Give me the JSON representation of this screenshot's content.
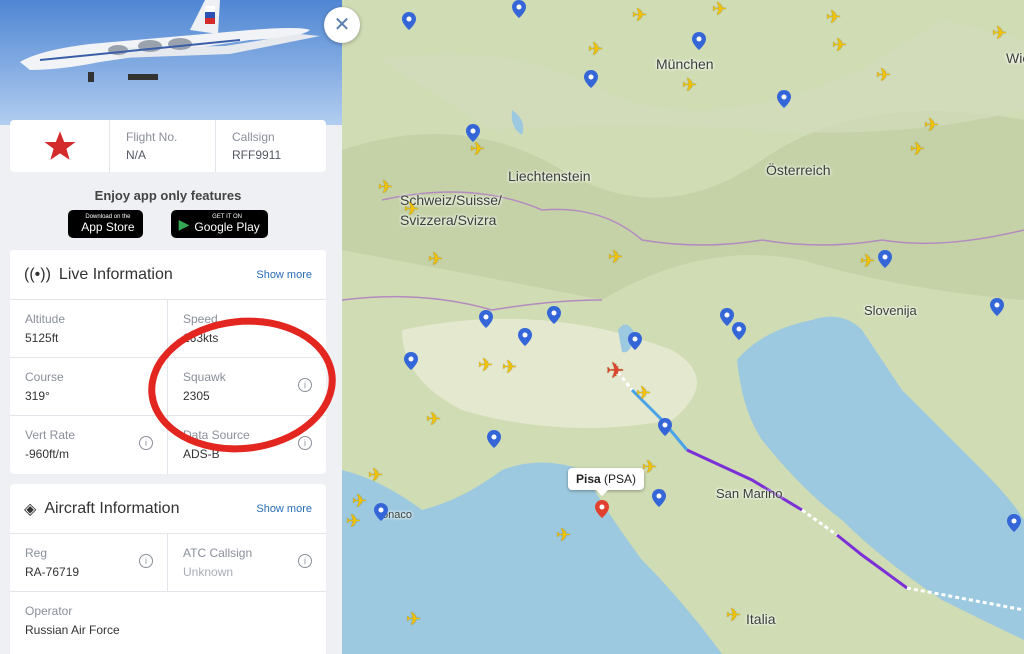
{
  "flight": {
    "flight_no_label": "Flight No.",
    "flight_no_value": "N/A",
    "callsign_label": "Callsign",
    "callsign_value": "RFF9911"
  },
  "promo": {
    "title": "Enjoy app only features",
    "appstore_small": "Download on the",
    "appstore_big": "App Store",
    "googleplay_small": "GET IT ON",
    "googleplay_big": "Google Play"
  },
  "live": {
    "title": "Live Information",
    "show_more": "Show more",
    "altitude_label": "Altitude",
    "altitude_value": "5125ft",
    "speed_label": "Speed",
    "speed_value": "163kts",
    "course_label": "Course",
    "course_value": "319°",
    "squawk_label": "Squawk",
    "squawk_value": "2305",
    "vert_rate_label": "Vert Rate",
    "vert_rate_value": "-960ft/m",
    "data_source_label": "Data Source",
    "data_source_value": "ADS-B"
  },
  "aircraft": {
    "title": "Aircraft Information",
    "show_more": "Show more",
    "reg_label": "Reg",
    "reg_value": "RA-76719",
    "atc_label": "ATC Callsign",
    "atc_value": "Unknown",
    "operator_label": "Operator",
    "operator_value": "Russian Air Force"
  },
  "map": {
    "labels": {
      "munchen": "München",
      "wien": "Wie",
      "liechtenstein": "Liechtenstein",
      "osterreich": "Österreich",
      "schweiz1": "Schweiz/Suisse/",
      "schweiz2": "Svizzera/Svizra",
      "slovenija": "Slovenija",
      "sanmarino": "San Marino",
      "monaco": "onaco",
      "italia": "Italia"
    },
    "airport_name": "Pisa",
    "airport_code": "(PSA)"
  },
  "colors": {
    "annotation": "#e3261f",
    "track_purple": "#7b2fd6",
    "track_blue": "#4aa3e8",
    "plane_yellow": "#f3c200",
    "selected_plane": "#e0412e",
    "link": "#2a6db5"
  }
}
